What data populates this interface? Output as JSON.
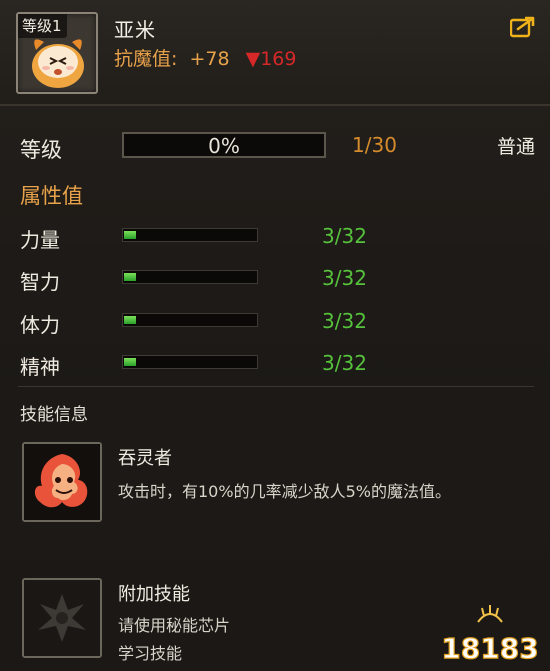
{
  "header": {
    "level_tag": "等级1",
    "pet_name": "亚米",
    "resist_label": "抗魔值:",
    "resist_plus": "+78",
    "resist_down": "▼169"
  },
  "level": {
    "label": "等级",
    "percent_text": "0%",
    "progress": 0,
    "count": "1/30",
    "quality": "普通"
  },
  "attributes": {
    "title": "属性值",
    "items": [
      {
        "label": "力量",
        "value": "3/32",
        "fraction": 0.094
      },
      {
        "label": "智力",
        "value": "3/32",
        "fraction": 0.094
      },
      {
        "label": "体力",
        "value": "3/32",
        "fraction": 0.094
      },
      {
        "label": "精神",
        "value": "3/32",
        "fraction": 0.094
      }
    ]
  },
  "skills": {
    "title": "技能信息",
    "list": [
      {
        "name": "吞灵者",
        "desc": "攻击时，有10%的几率减少敌人5%的魔法值。"
      },
      {
        "name": "附加技能",
        "desc_line1": "请使用秘能芯片",
        "desc_line2": "学习技能"
      }
    ]
  },
  "watermark": {
    "text": "18183"
  },
  "colors": {
    "accent_orange": "#e8a24a",
    "stat_green": "#56c23c",
    "resist_red": "#d62828"
  }
}
